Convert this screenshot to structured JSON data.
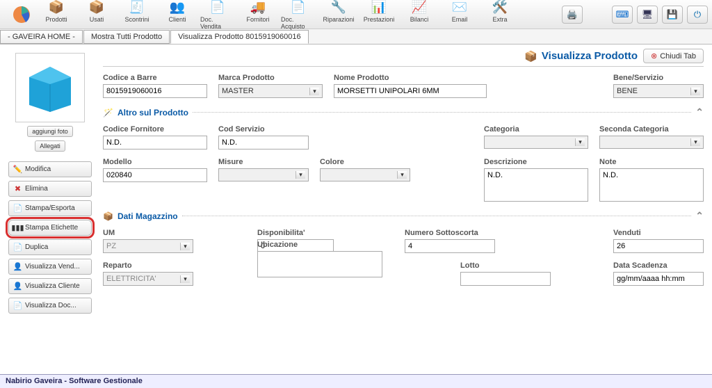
{
  "toolbar": {
    "items": [
      {
        "label": "Prodotti"
      },
      {
        "label": "Usati"
      },
      {
        "label": "Scontrini"
      },
      {
        "label": "Clienti"
      },
      {
        "label": "Doc. Vendita"
      },
      {
        "label": "Fornitori"
      },
      {
        "label": "Doc. Acquisto"
      },
      {
        "label": "Riparazioni"
      },
      {
        "label": "Prestazioni"
      },
      {
        "label": "Bilanci"
      },
      {
        "label": "Email"
      },
      {
        "label": "Extra"
      }
    ]
  },
  "tabs": {
    "home": "- GAVEIRA HOME -",
    "all": "Mostra Tutti Prodotto",
    "view": "Visualizza Prodotto 8015919060016"
  },
  "header": {
    "title": "Visualizza Prodotto",
    "close": "Chiudi Tab"
  },
  "sidebar": {
    "addPhoto": "aggiungi foto",
    "attach": "Allegati",
    "edit": "Modifica",
    "delete": "Elimina",
    "print": "Stampa/Esporta",
    "labels": "Stampa Etichette",
    "dup": "Duplica",
    "vSales": "Visualizza Vend...",
    "vClient": "Visualizza Cliente",
    "vDoc": "Visualizza Doc..."
  },
  "form": {
    "barcode_lbl": "Codice a Barre",
    "barcode": "8015919060016",
    "brand_lbl": "Marca Prodotto",
    "brand": "MASTER",
    "name_lbl": "Nome Prodotto",
    "name": "MORSETTI UNIPOLARI 6MM",
    "type_lbl": "Bene/Servizio",
    "type": "BENE"
  },
  "sec_alt": "Altro sul Prodotto",
  "alt": {
    "supplier_lbl": "Codice Fornitore",
    "supplier": "N.D.",
    "service_lbl": "Cod Servizio",
    "service": "N.D.",
    "cat_lbl": "Categoria",
    "cat": "",
    "cat2_lbl": "Seconda Categoria",
    "cat2": "",
    "model_lbl": "Modello",
    "model": "020840",
    "size_lbl": "Misure",
    "size": "",
    "color_lbl": "Colore",
    "color": "",
    "desc_lbl": "Descrizione",
    "desc": "N.D.",
    "note_lbl": "Note",
    "note": "N.D."
  },
  "sec_mag": "Dati Magazzino",
  "mag": {
    "um_lbl": "UM",
    "um": "PZ",
    "avail_lbl": "Disponibilita'",
    "avail": "0",
    "reorder_lbl": "Numero Sottoscorta",
    "reorder": "4",
    "sold_lbl": "Venduti",
    "sold": "26",
    "dept_lbl": "Reparto",
    "dept": "ELETTRICITA'",
    "loc_lbl": "Ubicazione",
    "loc": "",
    "lot_lbl": "Lotto",
    "lot": "",
    "exp_lbl": "Data Scadenza",
    "exp": "gg/mm/aaaa hh:mm"
  },
  "footer": "Nabirio Gaveira - Software Gestionale"
}
